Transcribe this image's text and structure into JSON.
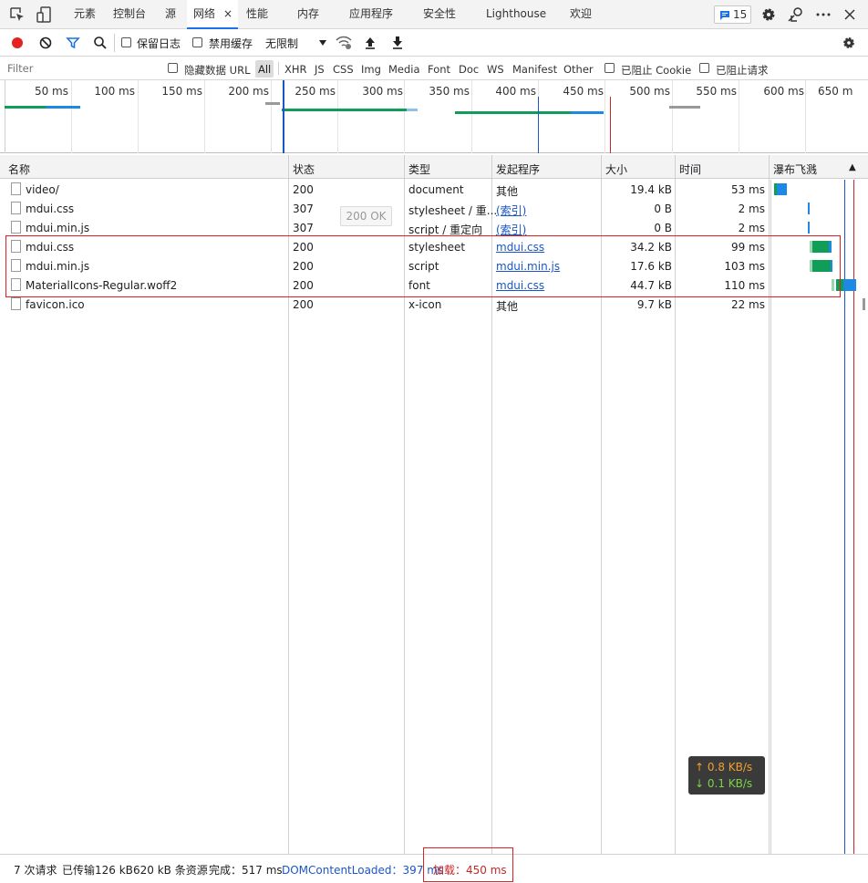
{
  "tabs": {
    "items": [
      "元素",
      "控制台",
      "源",
      "网络",
      "性能",
      "内存",
      "应用程序",
      "安全性",
      "Lighthouse",
      "欢迎"
    ],
    "close": "×",
    "badge_count": "15"
  },
  "toolbar": {
    "preserve_log": "保留日志",
    "disable_cache": "禁用缓存",
    "throttle": "无限制"
  },
  "filter": {
    "placeholder": "Filter",
    "hide_data_urls": "隐藏数据 URL",
    "types": [
      "All",
      "XHR",
      "JS",
      "CSS",
      "Img",
      "Media",
      "Font",
      "Doc",
      "WS",
      "Manifest",
      "Other"
    ],
    "blocked_cookies": "已阻止 Cookie",
    "blocked_requests": "已阻止请求"
  },
  "overview": {
    "ticks": [
      "50 ms",
      "100 ms",
      "150 ms",
      "200 ms",
      "250 ms",
      "300 ms",
      "350 ms",
      "400 ms",
      "450 ms",
      "500 ms",
      "550 ms",
      "600 ms",
      "650 m"
    ]
  },
  "table": {
    "headers": [
      "名称",
      "状态",
      "类型",
      "发起程序",
      "大小",
      "时间",
      "瀑布飞溅"
    ],
    "sort_arrow": "▲",
    "rows": [
      {
        "name": "video/",
        "status": "200",
        "type": "document",
        "initiator": "其他",
        "size": "19.4 kB",
        "time": "53 ms"
      },
      {
        "name": "mdui.css",
        "status": "307",
        "type": "stylesheet / 重...",
        "initiator": "(索引)",
        "size": "0 B",
        "time": "2 ms"
      },
      {
        "name": "mdui.min.js",
        "status": "307",
        "type": "script / 重定向",
        "initiator": "(索引)",
        "size": "0 B",
        "time": "2 ms"
      },
      {
        "name": "mdui.css",
        "status": "200",
        "type": "stylesheet",
        "initiator": "mdui.css",
        "size": "34.2 kB",
        "time": "99 ms"
      },
      {
        "name": "mdui.min.js",
        "status": "200",
        "type": "script",
        "initiator": "mdui.min.js",
        "size": "17.6 kB",
        "time": "103 ms"
      },
      {
        "name": "MaterialIcons-Regular.woff2",
        "status": "200",
        "type": "font",
        "initiator": "mdui.css",
        "size": "44.7 kB",
        "time": "110 ms"
      },
      {
        "name": "favicon.ico",
        "status": "200",
        "type": "x-icon",
        "initiator": "其他",
        "size": "9.7 kB",
        "time": "22 ms"
      }
    ],
    "tooltip": "200 OK"
  },
  "speed": {
    "up": "↑ 0.8 KB/s",
    "down": "↓ 0.1 KB/s"
  },
  "status": {
    "requests": "7 次请求",
    "transferred": "已传输126 kB",
    "resources": "620 kB 条资源",
    "finish": "完成：517 ms",
    "dcl": "DOMContentLoaded：397 ms",
    "load": "加载：450 ms"
  },
  "colors": {
    "accent": "#1a73e8",
    "highlight": "#e02020",
    "green": "#0f9d58",
    "blue": "#1e88e5"
  }
}
